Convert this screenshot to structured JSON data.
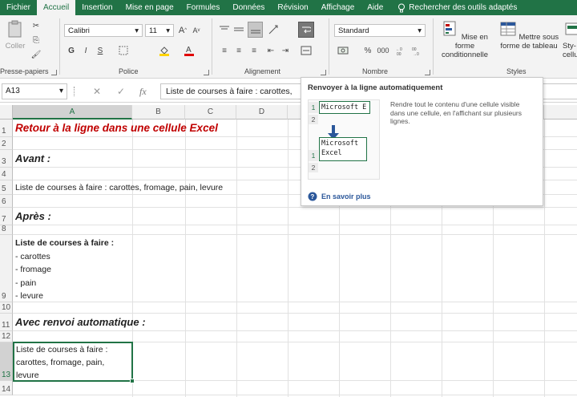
{
  "ribbon_tabs": [
    "Fichier",
    "Accueil",
    "Insertion",
    "Mise en page",
    "Formules",
    "Données",
    "Révision",
    "Affichage",
    "Aide"
  ],
  "search_label": "Rechercher des outils adaptés",
  "clipboard": {
    "paste_label": "Coller",
    "group_label": "Presse-papiers"
  },
  "font": {
    "name": "Calibri",
    "size": "11",
    "bold": "G",
    "italic": "I",
    "underline": "S",
    "group_label": "Police"
  },
  "alignment": {
    "group_label": "Alignement"
  },
  "number": {
    "format": "Standard",
    "percent": "%",
    "thousands": "000",
    "group_label": "Nombre"
  },
  "styles": {
    "conditional": "Mise en forme conditionnelle",
    "table": "Mettre sous forme de tableau",
    "cell_styles": "Sty-cellu",
    "group_label": "Styles"
  },
  "formula_bar": {
    "name_box": "A13",
    "fx": "fx",
    "content": "Liste de courses à faire : carottes,"
  },
  "columns": [
    "A",
    "B",
    "C",
    "D"
  ],
  "rows": [
    "1",
    "2",
    "3",
    "4",
    "5",
    "6",
    "7",
    "8",
    "9",
    "10",
    "11",
    "12",
    "13",
    "14"
  ],
  "cells": {
    "r1": "Retour à la ligne dans une cellule Excel",
    "r3": "Avant :",
    "r5": "Liste de courses à faire : carottes, fromage, pain, levure",
    "r7": "Après :",
    "r9_lines": [
      "Liste de courses à faire :",
      "- carottes",
      "- fromage",
      "- pain",
      "- levure"
    ],
    "r11": "Avec renvoi automatique :",
    "r13_lines": [
      "Liste de courses à faire :",
      "carottes, fromage, pain,",
      "levure"
    ]
  },
  "tooltip": {
    "title": "Renvoyer à la ligne automatiquement",
    "description": "Rendre tout le contenu d'une cellule visible dans une cellule, en l'affichant sur plusieurs lignes.",
    "more": "En savoir plus",
    "before_text": "Microsoft E",
    "after_line1": "Microsoft",
    "after_line2": "Excel",
    "row1": "1",
    "row2": "2"
  },
  "accent": "#217346",
  "title_color": "#c00000"
}
